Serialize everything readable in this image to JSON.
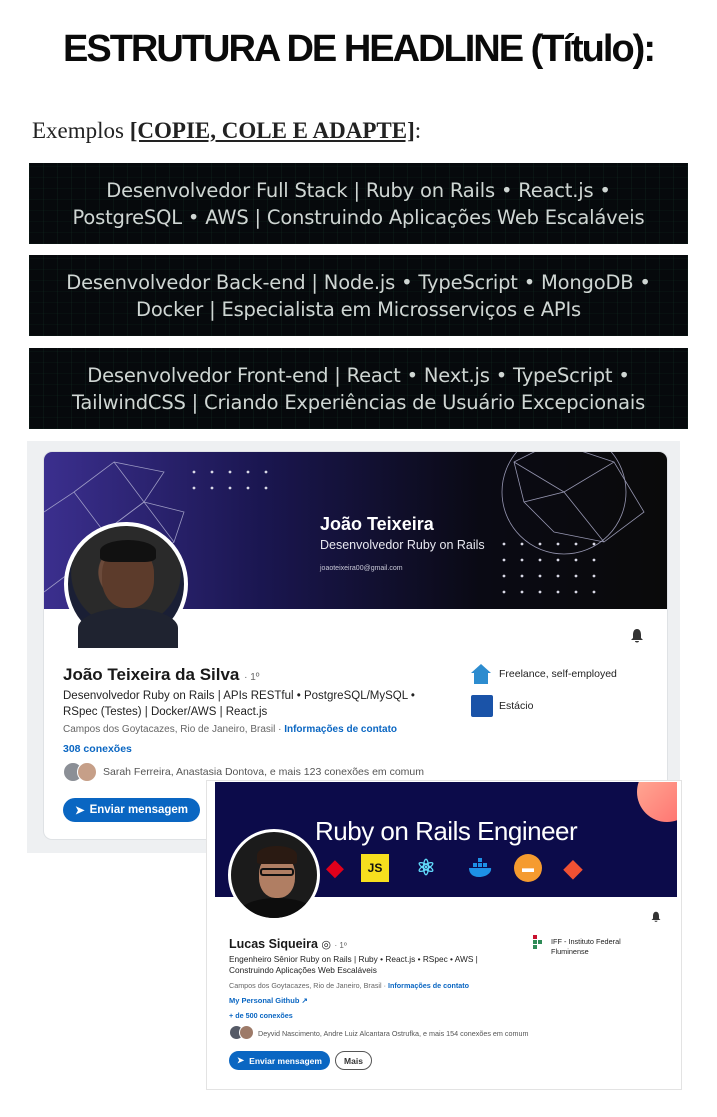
{
  "title": "ESTRUTURA DE HEADLINE (Título):",
  "examples": {
    "prefix": "Exemplos ",
    "bracket": "[COPIE, COLE E ADAPTE]",
    "suffix": ":"
  },
  "banners": [
    {
      "line1": "Desenvolvedor Full Stack | Ruby on Rails • React.js •",
      "line2": "PostgreSQL • AWS | Construindo Aplicações Web Escaláveis"
    },
    {
      "line1": "Desenvolvedor Back-end | Node.js • TypeScript • MongoDB •",
      "line2": "Docker | Especialista em Microsserviços e APIs"
    },
    {
      "line1": "Desenvolvedor Front-end | React • Next.js • TypeScript •",
      "line2": "TailwindCSS | Criando Experiências de Usuário Excepcionais"
    }
  ],
  "profile1": {
    "cover_name": "João Teixeira",
    "cover_role": "Desenvolvedor Ruby on Rails",
    "cover_email": "joaoteixeira00@gmail.com",
    "name": "João Teixeira da Silva",
    "degree": "· 1º",
    "headline_line1": "Desenvolvedor Ruby on Rails | APIs RESTful • PostgreSQL/MySQL •",
    "headline_line2": "RSpec (Testes) | Docker/AWS | React.js",
    "location": "Campos dos Goytacazes, Rio de Janeiro, Brasil · ",
    "contact_link": "Informações de contato",
    "connections": "308 conexões",
    "mutual": "Sarah Ferreira, Anastasia Dontova, e mais 123 conexões em comum",
    "message_button": "Enviar mensagem",
    "company1": "Freelance, self-employed",
    "company2": "Estácio",
    "bell_icon": "bell-icon"
  },
  "profile2": {
    "cover_title": "Ruby on Rails Engineer",
    "name": "Lucas Siqueira",
    "degree": "· 1º",
    "headline_line1": "Engenheiro Sênior Ruby on Rails | Ruby • React.js • RSpec • AWS |",
    "headline_line2": "Construindo Aplicações Web Escaláveis",
    "location": "Campos dos Goytacazes, Rio de Janeiro, Brasil · ",
    "contact_link": "Informações de contato",
    "github_link": "My Personal Github",
    "connections": "+ de 500 conexões",
    "mutual": "Deyvid Nascimento, Andre Luiz Alcantara Ostrufka, e mais 154 conexões em comum",
    "message_button": "Enviar mensagem",
    "more_button": "Mais",
    "institution_line1": "IFF - Instituto Federal",
    "institution_line2": "Fluminense",
    "js_label": "JS"
  }
}
